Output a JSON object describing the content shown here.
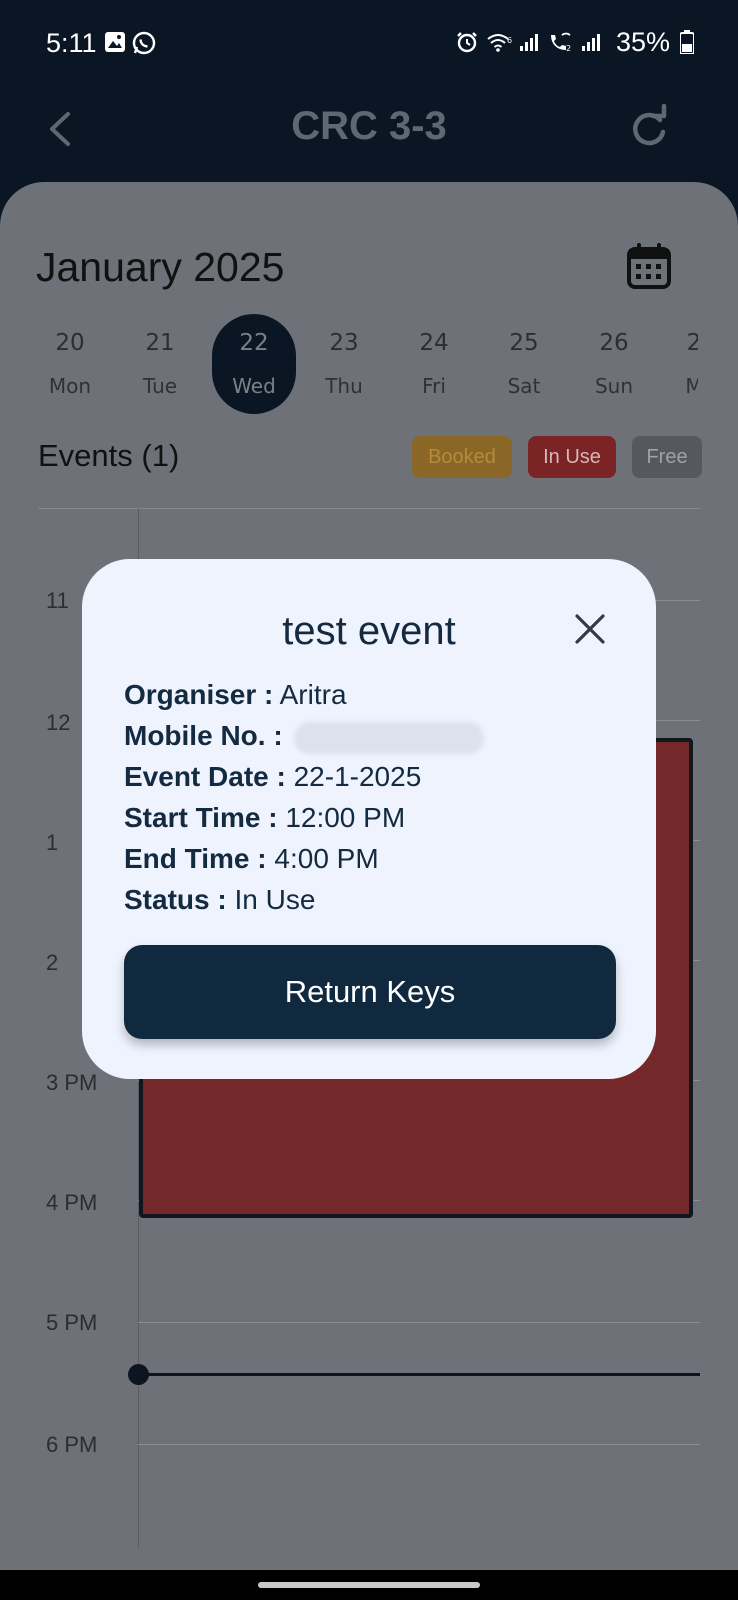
{
  "status_bar": {
    "time": "5:11",
    "battery": "35%",
    "icons": [
      "gallery-icon",
      "whatsapp-icon",
      "alarm-icon",
      "wifi-icon",
      "signal-icon",
      "wifi-call-icon",
      "signal-icon",
      "battery-icon"
    ]
  },
  "header": {
    "title": "CRC 3-3",
    "back_icon": "chevron-left-icon",
    "refresh_icon": "refresh-icon"
  },
  "calendar": {
    "month_label": "January 2025",
    "calendar_icon": "calendar-icon",
    "days": [
      {
        "num": "20",
        "wd": "Mon"
      },
      {
        "num": "21",
        "wd": "Tue"
      },
      {
        "num": "22",
        "wd": "Wed"
      },
      {
        "num": "23",
        "wd": "Thu"
      },
      {
        "num": "24",
        "wd": "Fri"
      },
      {
        "num": "25",
        "wd": "Sat"
      },
      {
        "num": "26",
        "wd": "Sun"
      },
      {
        "num": "2",
        "wd": "M"
      }
    ],
    "selected_day": "22"
  },
  "events": {
    "title": "Events (1)",
    "legend": {
      "booked": "Booked",
      "in_use": "In Use",
      "free": "Free"
    },
    "hours": [
      "11",
      "12",
      "1",
      "2",
      "3 PM",
      "4 PM",
      "5 PM",
      "6 PM"
    ]
  },
  "dialog": {
    "title": "test event",
    "close_icon": "close-icon",
    "rows": [
      {
        "key": "Organiser :",
        "value": "Aritra"
      },
      {
        "key": "Mobile No. :",
        "value": ""
      },
      {
        "key": "Event Date :",
        "value": "22-1-2025"
      },
      {
        "key": "Start Time :",
        "value": "12:00 PM"
      },
      {
        "key": "End Time :",
        "value": "4:00 PM"
      },
      {
        "key": "Status :",
        "value": "In Use"
      }
    ],
    "button_label": "Return Keys"
  },
  "colors": {
    "header_bg": "#0b1624",
    "dialog_bg": "#eff3fe",
    "primary": "#10293f",
    "booked": "#b78a3c",
    "in_use": "#c0393c",
    "free": "#8a8d90"
  }
}
